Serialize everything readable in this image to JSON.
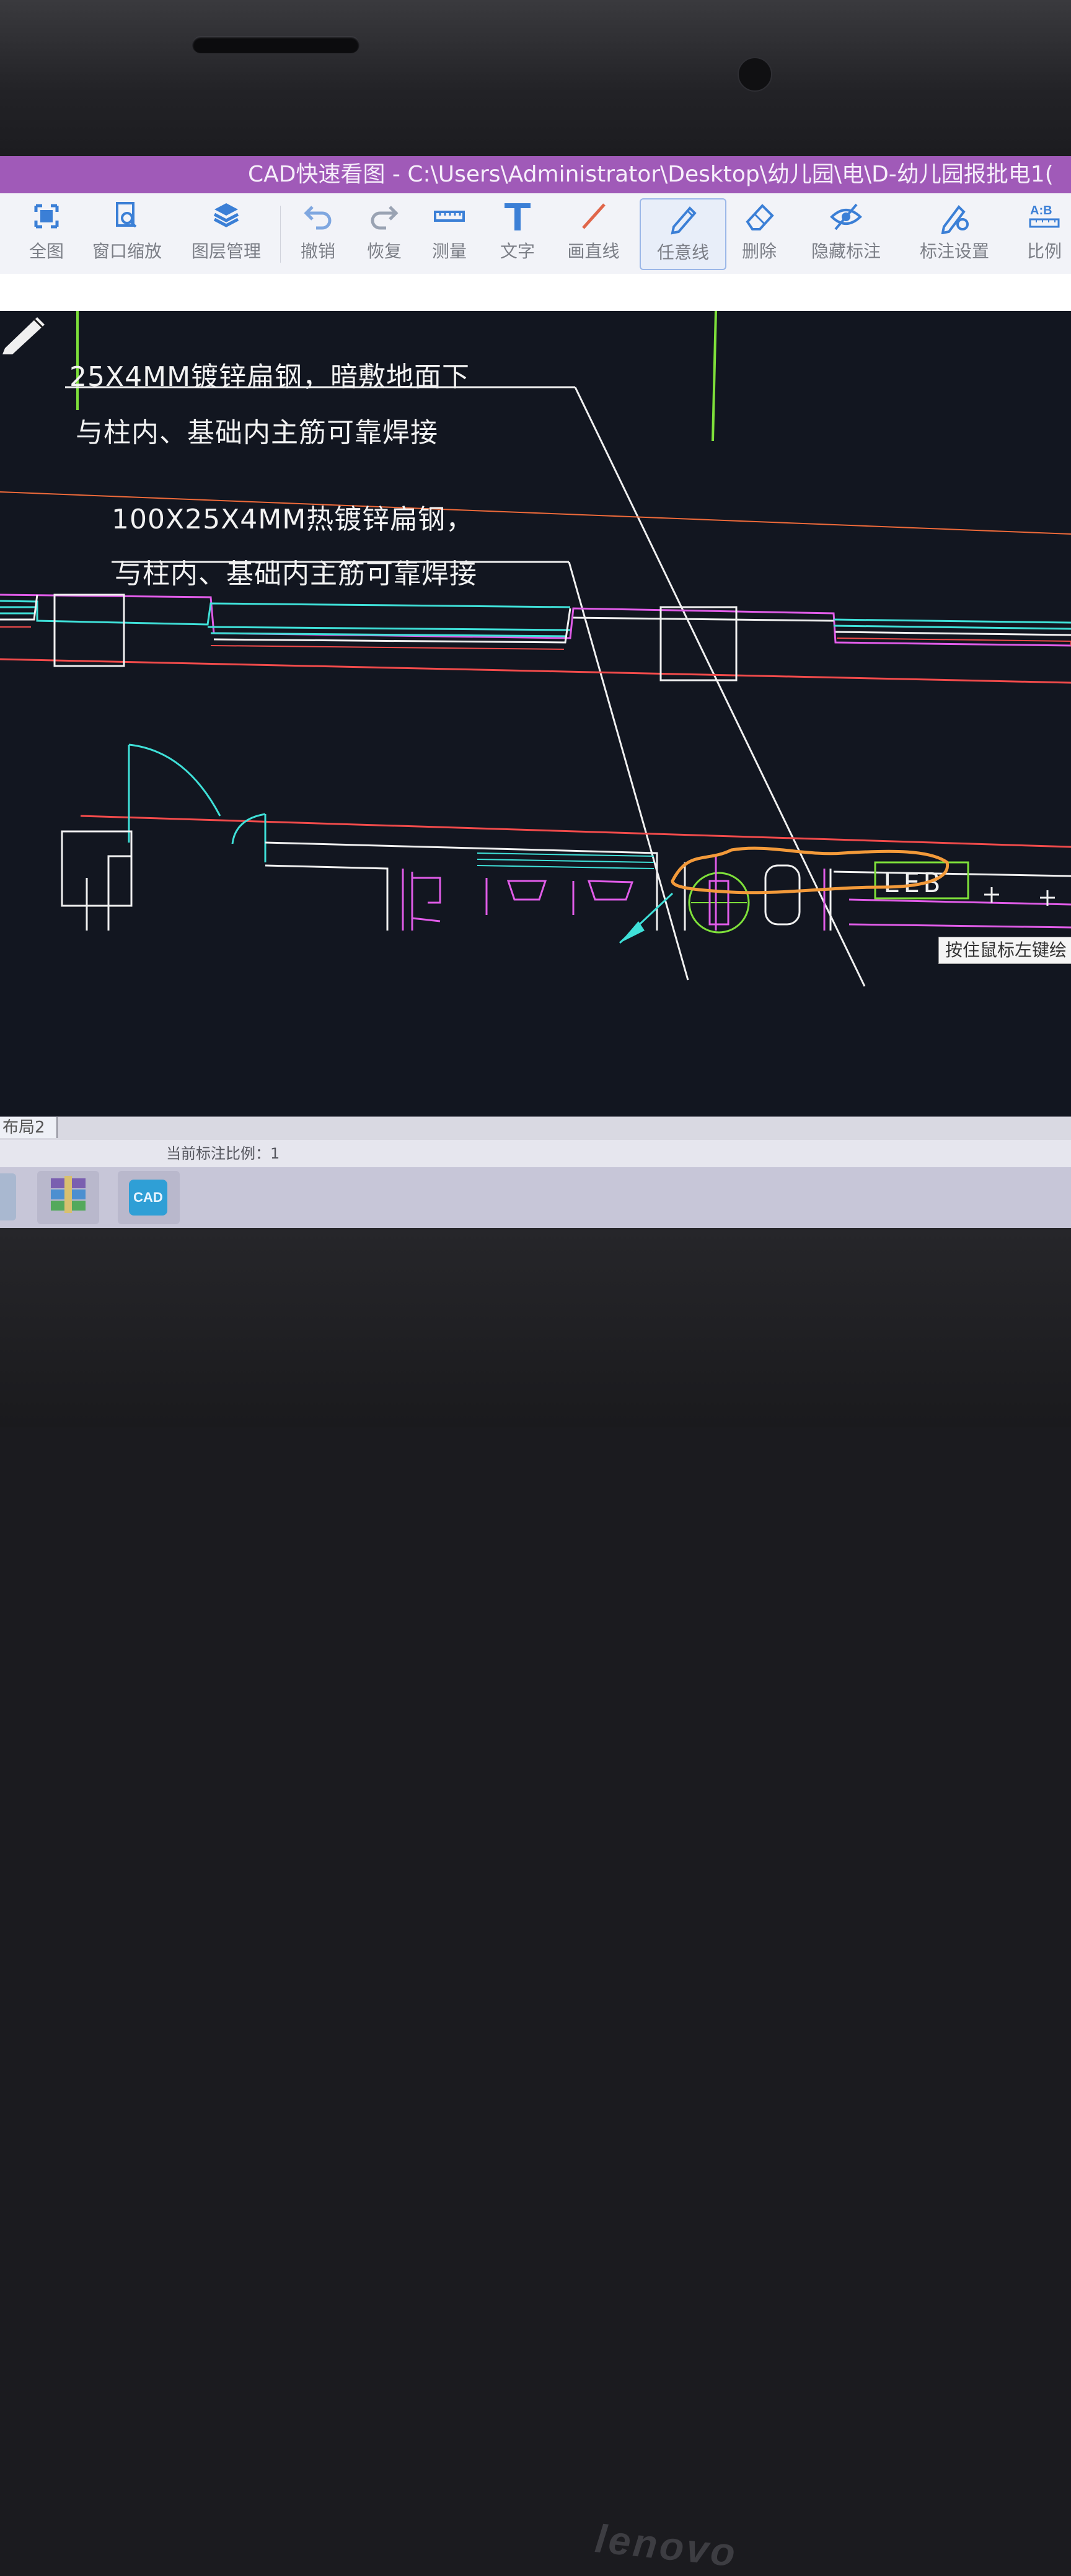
{
  "window": {
    "title": "CAD快速看图 - C:\\Users\\Administrator\\Desktop\\幼儿园\\电\\D-幼儿园报批电1("
  },
  "toolbar": {
    "items": [
      {
        "label": "全图",
        "icon": "fit-all-icon"
      },
      {
        "label": "窗口缩放",
        "icon": "window-zoom-icon"
      },
      {
        "label": "图层管理",
        "icon": "layers-icon"
      },
      {
        "label": "撤销",
        "icon": "undo-icon"
      },
      {
        "label": "恢复",
        "icon": "redo-icon"
      },
      {
        "label": "测量",
        "icon": "ruler-icon"
      },
      {
        "label": "文字",
        "icon": "text-icon"
      },
      {
        "label": "画直线",
        "icon": "line-icon"
      },
      {
        "label": "任意线",
        "icon": "freehand-pen-icon",
        "active": true
      },
      {
        "label": "删除",
        "icon": "eraser-icon"
      },
      {
        "label": "隐藏标注",
        "icon": "hide-eye-icon"
      },
      {
        "label": "标注设置",
        "icon": "annotation-settings-icon"
      },
      {
        "label": "比例",
        "icon": "scale-icon"
      }
    ]
  },
  "drawing": {
    "annotation_1_line1": "25X4MM镀锌扁钢，暗敷地面下",
    "annotation_1_line2": "与柱内、基础内主筋可靠焊接",
    "annotation_2_line1": "100X25X4MM热镀锌扁钢，",
    "annotation_2_line2": "与柱内、基础内主筋可靠焊接",
    "equipment_label": "LEB",
    "colors": {
      "line_white": "#f0f0f0",
      "line_cyan": "#3fe0d8",
      "line_magenta": "#e05ce8",
      "line_red": "#f24b4b",
      "line_green": "#7ee03a",
      "markup_orange": "#f39a3a"
    }
  },
  "tooltip": "按住鼠标左键绘",
  "layout_tab": "布局2",
  "status": {
    "annotation_scale": "当前标注比例：1"
  },
  "taskbar": {
    "apps": [
      {
        "name": "archive-app-icon"
      },
      {
        "name": "cad-app-icon",
        "label": "CAD"
      }
    ]
  }
}
